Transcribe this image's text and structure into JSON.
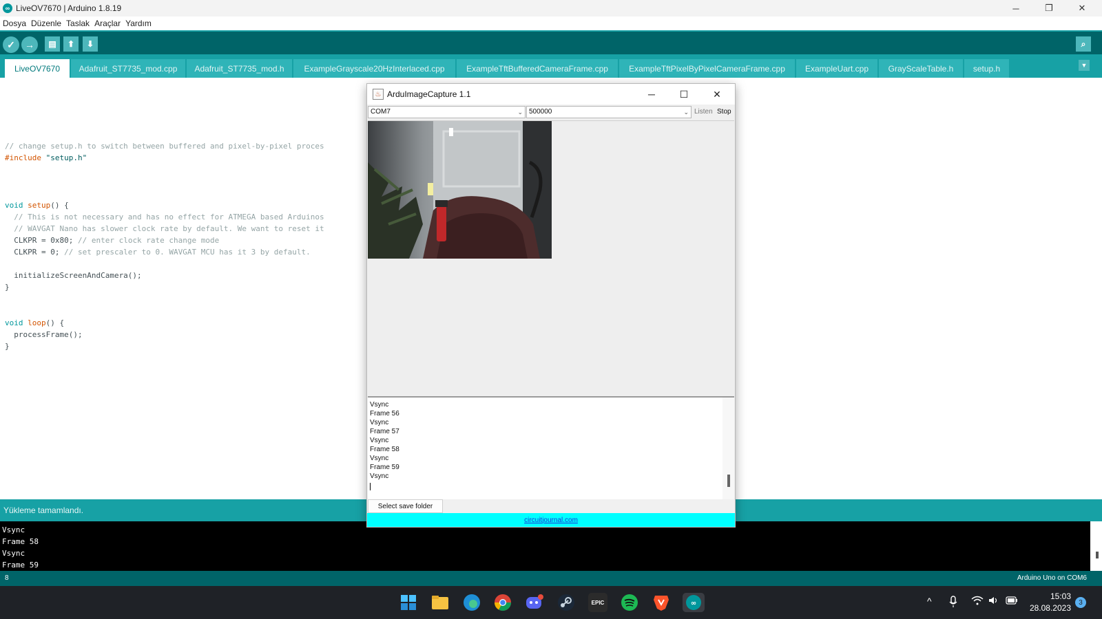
{
  "window": {
    "title": "LiveOV7670 | Arduino 1.8.19",
    "minimize": "─",
    "restore": "❐",
    "close": "✕"
  },
  "menu": [
    "Dosya",
    "Düzenle",
    "Taslak",
    "Araçlar",
    "Yardım"
  ],
  "toolbar": {
    "verify_icon": "✓",
    "upload_icon": "→",
    "new_icon": "▤",
    "open_icon": "⬆",
    "save_icon": "⬇",
    "serial_monitor_icon": "⌕"
  },
  "tabs": [
    {
      "label": "LiveOV7670",
      "active": true
    },
    {
      "label": "Adafruit_ST7735_mod.cpp"
    },
    {
      "label": "Adafruit_ST7735_mod.h"
    },
    {
      "label": "ExampleGrayscale20HzInterlaced.cpp"
    },
    {
      "label": "ExampleTftBufferedCameraFrame.cpp"
    },
    {
      "label": "ExampleTftPixelByPixelCameraFrame.cpp"
    },
    {
      "label": "ExampleUart.cpp"
    },
    {
      "label": "GrayScaleTable.h"
    },
    {
      "label": "setup.h"
    }
  ],
  "tab_menu_icon": "▼",
  "code": {
    "l1": "// change setup.h to switch between buffered and pixel-by-pixel proces",
    "l2_kw": "#include",
    "l2_str": " \"setup.h\"",
    "l3_kw": "void",
    "l3_fn": " setup",
    "l3_rest": "() {",
    "l4": "  // This is not necessary and has no effect for ATMEGA based Arduinos",
    "l5": "  // WAVGAT Nano has slower clock rate by default. We want to reset it",
    "l6_code": "  CLKPR = 0x80; ",
    "l6_comment": "// enter clock rate change mode",
    "l7_code": "  CLKPR = 0; ",
    "l7_comment": "// set prescaler to 0. WAVGAT MCU has it 3 by default.",
    "l8": "  initializeScreenAndCamera();",
    "l9": "}",
    "l10_kw": "void",
    "l10_fn": " loop",
    "l10_rest": "() {",
    "l11": "  processFrame();",
    "l12": "}"
  },
  "status": {
    "message": "Yükleme tamamlandı."
  },
  "console": [
    "Vsync",
    "Frame 58",
    "Vsync",
    "Frame 59"
  ],
  "bottom": {
    "line": "8",
    "board": "Arduino Uno on COM6"
  },
  "capture": {
    "title": "ArduImageCapture 1.1",
    "title_icon": "♨",
    "port": "COM7",
    "baud": "500000",
    "combo_arrow": "⌄",
    "listen": "Listen",
    "stop": "Stop",
    "log": [
      "Vsync",
      "Frame 56",
      "Vsync",
      "Frame 57",
      "Vsync",
      "Frame 58",
      "Vsync",
      "Frame 59",
      "Vsync"
    ],
    "save_folder": "Select save folder",
    "link": "circuitjournal.com",
    "minimize": "─",
    "maximize": "☐",
    "close": "✕"
  },
  "taskbar": {
    "start_icon": "windows-start",
    "apps": [
      "file-explorer",
      "edge",
      "chrome",
      "discord",
      "steam",
      "epic-games",
      "spotify",
      "brave",
      "arduino"
    ],
    "tray_up": "^",
    "mic": "🎙",
    "wifi": "wifi",
    "volume": "🔊",
    "battery": "battery",
    "time": "15:03",
    "date": "28.08.2023",
    "notifications": "3"
  }
}
